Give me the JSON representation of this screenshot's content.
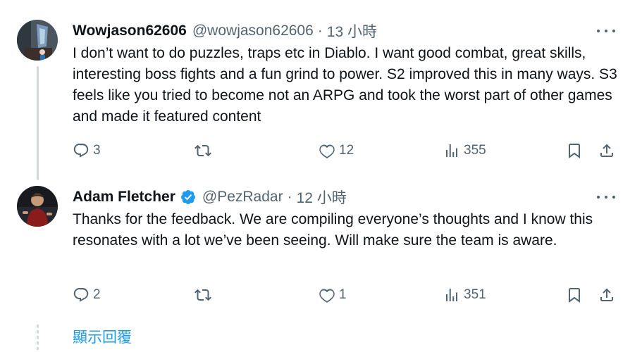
{
  "tweets": [
    {
      "display_name": "Wowjason62606",
      "handle": "@wowjason62606",
      "separator": "·",
      "time": "13 小時",
      "text": "I don’t want to do puzzles, traps etc in Diablo. I want good combat, great skills, interesting boss fights and a fun grind to power. S2 improved this in many ways. S3 feels like you tried to become not an ARPG and took the worst part of other games and made it featured content",
      "verified": false,
      "replies": "3",
      "retweets": "",
      "likes": "12",
      "views": "355"
    },
    {
      "display_name": "Adam Fletcher",
      "handle": "@PezRadar",
      "separator": "·",
      "time": "12 小時",
      "text": "Thanks for the feedback. We are compiling everyone’s thoughts and I know this resonates with a lot we’ve been seeing. Will make sure the team is aware.",
      "verified": true,
      "replies": "2",
      "retweets": "",
      "likes": "1",
      "views": "351"
    }
  ],
  "show_replies_label": "顯示回覆",
  "colors": {
    "text": "#0f1419",
    "secondary": "#536471",
    "accent": "#1d9bf0",
    "line": "#cfd9de"
  },
  "icons": [
    "more-icon",
    "reply-icon",
    "retweet-icon",
    "like-icon",
    "views-icon",
    "bookmark-icon",
    "share-icon",
    "verified-icon"
  ]
}
